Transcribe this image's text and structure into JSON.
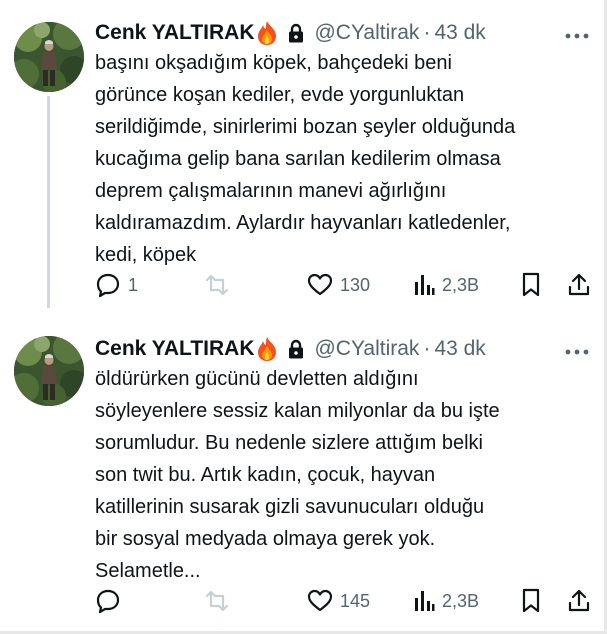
{
  "tweets": [
    {
      "author_name": "Cenk YALTIRAK",
      "handle": "@CYaltirak",
      "separator": "·",
      "time": "43 dk",
      "text_lines": [
        "başını okşadığım köpek, bahçedeki beni",
        "görünce koşan kediler, evde yorgunluktan",
        "serildiğimde, sinirlerimi bozan şeyler olduğunda",
        "kucağıma gelip bana sarılan kedilerim olmasa",
        "deprem çalışmalarının manevi ağırlığını",
        "kaldıramazdım. Aylardır hayvanları katledenler,",
        "kedi, köpek"
      ],
      "reply_count": "1",
      "retweet_count": "",
      "like_count": "130",
      "view_count": "2,3B"
    },
    {
      "author_name": "Cenk YALTIRAK",
      "handle": "@CYaltirak",
      "separator": "·",
      "time": "43 dk",
      "text_lines": [
        "öldürürken gücünü devletten aldığını",
        "söyleyenlere sessiz kalan milyonlar da bu işte",
        "sorumludur.  Bu nedenle sizlere attığım belki",
        "son twit bu.  Artık  kadın, çocuk, hayvan",
        "katillerinin  susarak gizli savunucuları olduğu",
        "bir sosyal medyada olmaya gerek yok.",
        "Selametle..."
      ],
      "reply_count": "",
      "retweet_count": "",
      "like_count": "145",
      "view_count": "2,3B"
    }
  ],
  "icons": {
    "verified_badge": "fire-emoji-icon",
    "protected": "lock-icon",
    "more": "more-icon",
    "reply": "reply-icon",
    "retweet": "retweet-icon",
    "like": "heart-icon",
    "views": "views-icon",
    "bookmark": "bookmark-icon",
    "share": "share-icon"
  },
  "colors": {
    "text": "#0f1419",
    "secondary": "#536471",
    "retweet_disabled": "#c5d1d8",
    "thread_line": "#cfd9de"
  }
}
